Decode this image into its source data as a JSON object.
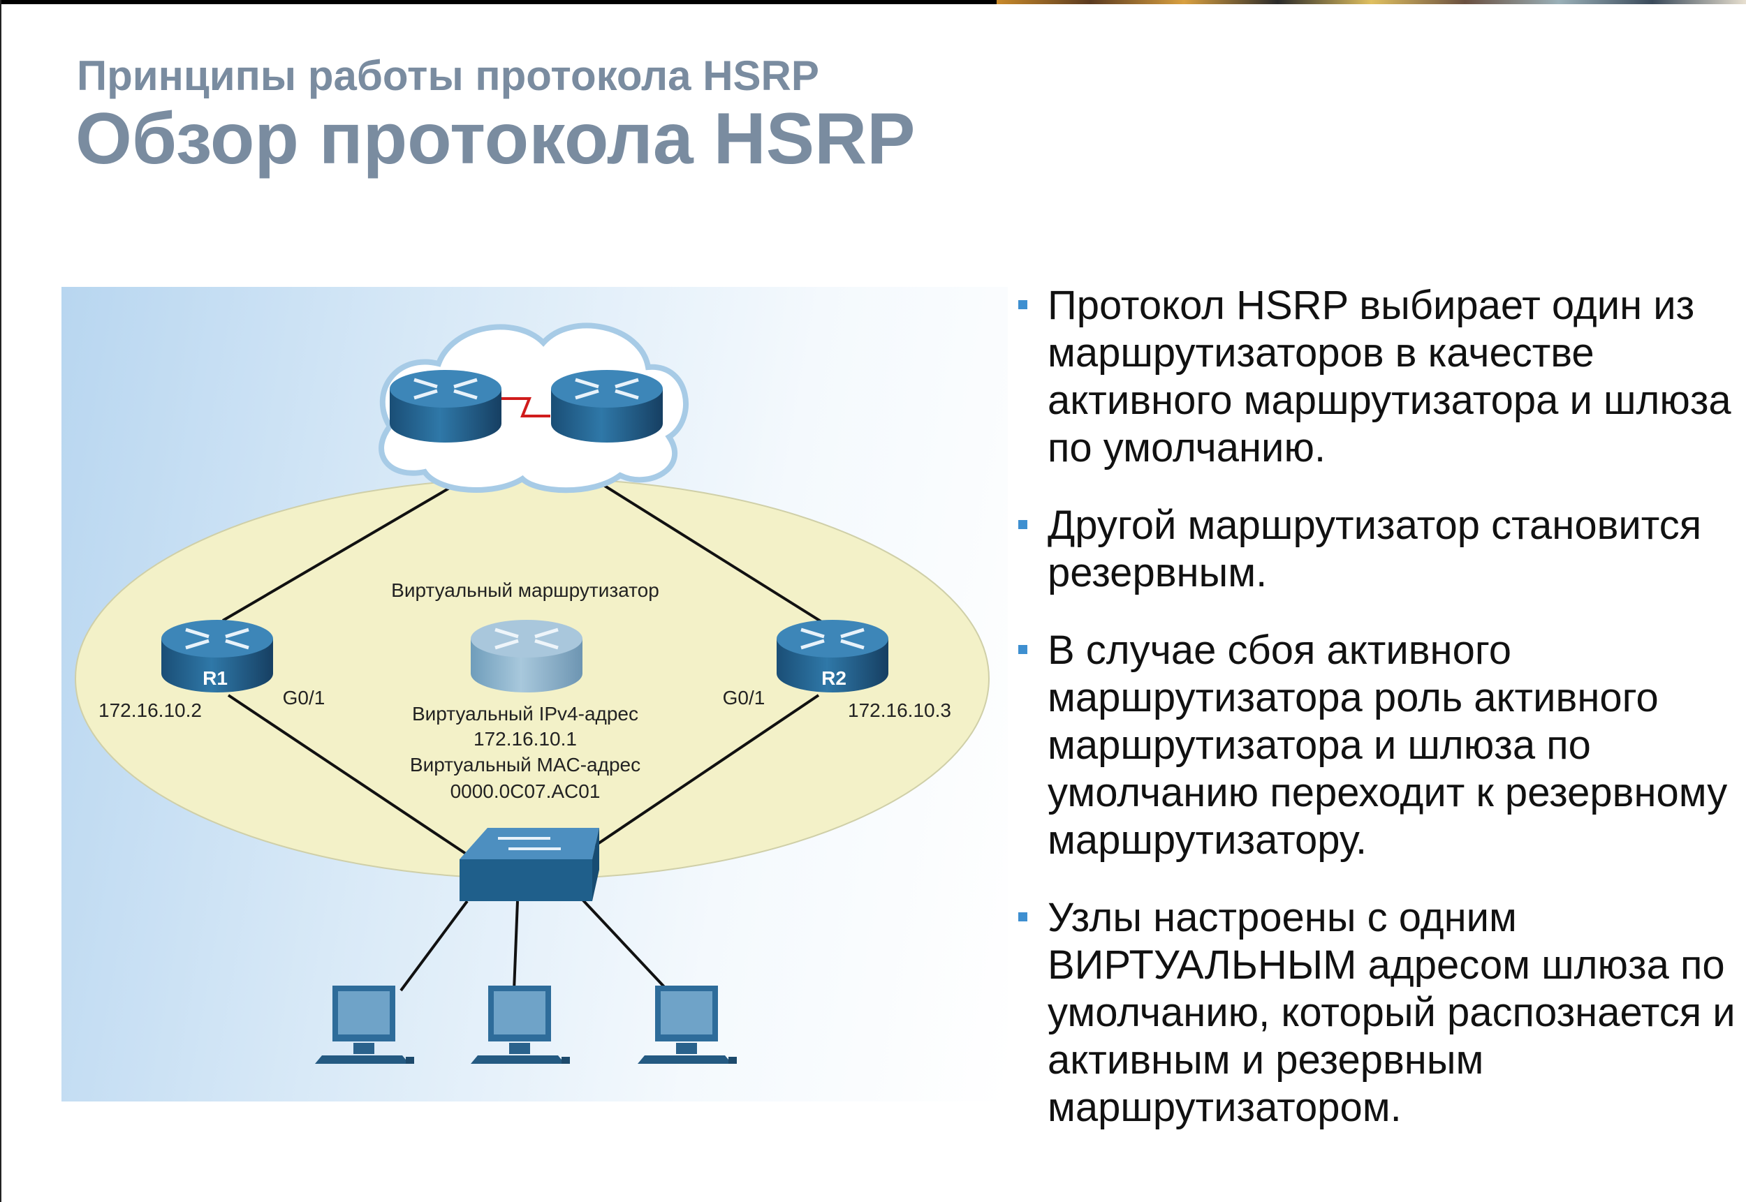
{
  "header": {
    "subtitle": "Принципы работы протокола HSRP",
    "title": "Обзор протокола HSRP"
  },
  "diagram": {
    "virtual_router_label": "Виртуальный маршрутизатор",
    "r1": {
      "name": "R1",
      "ip": "172.16.10.2",
      "interface": "G0/1"
    },
    "r2": {
      "name": "R2",
      "ip": "172.16.10.3",
      "interface": "G0/1"
    },
    "virtual_ipv4_label": "Виртуальный IPv4-адрес",
    "virtual_ipv4": "172.16.10.1",
    "virtual_mac_label": "Виртуальный MAC-адрес",
    "virtual_mac": "0000.0C07.AC01"
  },
  "bullets": [
    "Протокол HSRP выбирает один из маршрутизаторов в качестве активного маршрутизатора и шлюза по умолчанию.",
    "Другой маршрутизатор становится резервным.",
    "В случае сбоя активного маршрутизатора роль активного маршрутизатора и шлюза по умолчанию переходит к резервному маршрутизатору.",
    "Узлы настроены с одним ВИРТУАЛЬНЫМ адресом шлюза по умолчанию, который распознается и активным и резервным маршрутизатором."
  ],
  "colors": {
    "title": "#7a8ca0",
    "router": "#1f5f8b",
    "ellipse": "#f3f1c8",
    "bullet": "#3e8fd0"
  }
}
